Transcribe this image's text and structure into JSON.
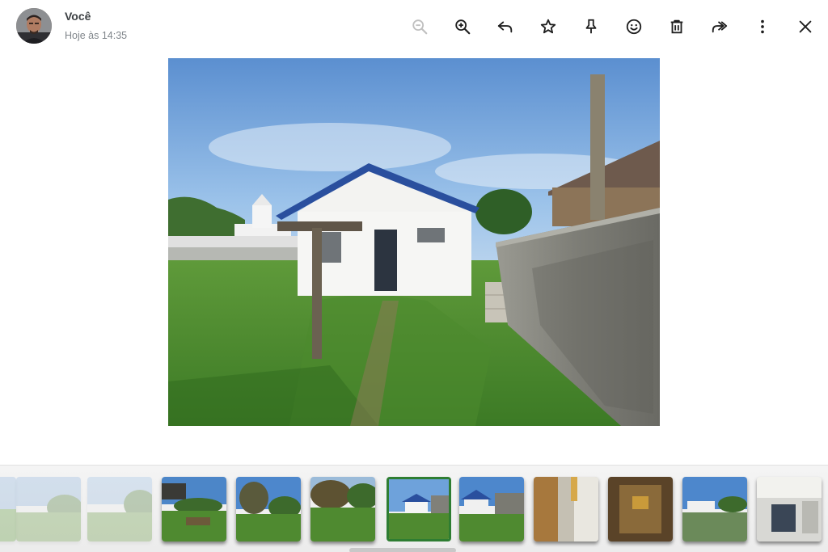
{
  "header": {
    "sender_name": "Você",
    "timestamp": "Hoje às 14:35"
  },
  "toolbar": {
    "buttons": [
      {
        "name": "zoom-out",
        "icon": "zoom-out-icon",
        "enabled": false
      },
      {
        "name": "zoom-in",
        "icon": "zoom-in-icon",
        "enabled": true
      },
      {
        "name": "reply",
        "icon": "reply-icon",
        "enabled": true
      },
      {
        "name": "star",
        "icon": "star-icon",
        "enabled": true
      },
      {
        "name": "pin",
        "icon": "pin-icon",
        "enabled": true
      },
      {
        "name": "react",
        "icon": "emoji-icon",
        "enabled": true
      },
      {
        "name": "delete",
        "icon": "trash-icon",
        "enabled": true
      },
      {
        "name": "forward",
        "icon": "forward-icon",
        "enabled": true
      },
      {
        "name": "more",
        "icon": "more-vert-icon",
        "enabled": true
      },
      {
        "name": "close",
        "icon": "close-icon",
        "enabled": true
      }
    ]
  },
  "main_image": {
    "subject": "house-yard-photo"
  },
  "filmstrip": {
    "thumbnails": [
      {
        "index": 0,
        "state": "faded",
        "selected": false
      },
      {
        "index": 1,
        "state": "faded",
        "selected": false
      },
      {
        "index": 2,
        "state": "normal",
        "selected": false
      },
      {
        "index": 3,
        "state": "normal",
        "selected": false
      },
      {
        "index": 4,
        "state": "normal",
        "selected": false
      },
      {
        "index": 5,
        "state": "normal",
        "selected": false
      },
      {
        "index": 6,
        "state": "normal",
        "selected": true
      },
      {
        "index": 7,
        "state": "normal",
        "selected": false
      },
      {
        "index": 8,
        "state": "normal",
        "selected": false
      },
      {
        "index": 9,
        "state": "normal",
        "selected": false
      },
      {
        "index": 10,
        "state": "normal",
        "selected": false
      },
      {
        "index": 11,
        "state": "normal",
        "selected": false
      }
    ]
  },
  "colors": {
    "selected_border": "#2e7d32",
    "icon": "#1f1f1f",
    "muted_text": "#80868b"
  }
}
